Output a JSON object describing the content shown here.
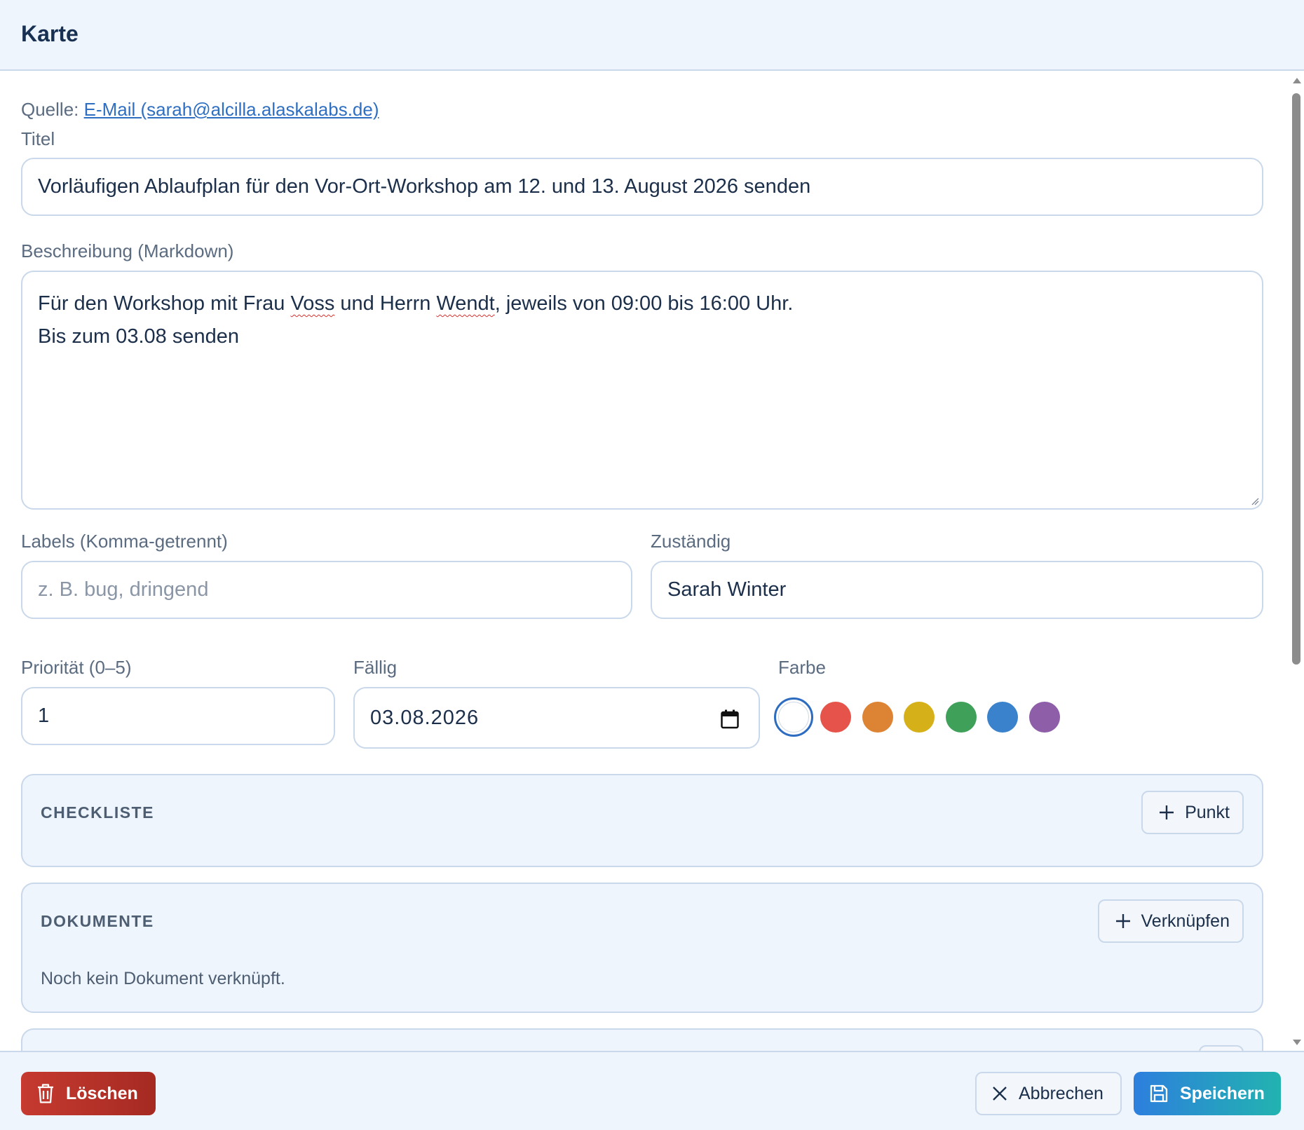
{
  "dialog": {
    "title": "Karte"
  },
  "source": {
    "label": "Quelle:",
    "link_text": "E-Mail (sarah@alcilla.alaskalabs.de)"
  },
  "title_field": {
    "label": "Titel",
    "value": "Vorläufigen Ablaufplan für den Vor-Ort-Workshop am 12. und 13. August 2026 senden"
  },
  "description": {
    "label": "Beschreibung (Markdown)",
    "line1_part1": "Für den Workshop mit Frau ",
    "line1_voss": "Voss",
    "line1_part2": " und Herrn ",
    "line1_wendt": "Wendt",
    "line1_part3": ", jeweils von 09:00 bis 16:00 Uhr.",
    "line2": "Bis zum 03.08 senden"
  },
  "labels_field": {
    "label": "Labels (Komma-getrennt)",
    "placeholder": "z. B. bug, dringend",
    "value": ""
  },
  "assignee_field": {
    "label": "Zuständig",
    "value": "Sarah Winter"
  },
  "priority_field": {
    "label": "Priorität (0–5)",
    "value": "1"
  },
  "due_field": {
    "label": "Fällig",
    "value": "03.08.2026"
  },
  "color_field": {
    "label": "Farbe",
    "selected": "none",
    "options": [
      "#ffffff",
      "#e5534b",
      "#dd8434",
      "#d5b019",
      "#3fa05a",
      "#3a83cc",
      "#8e5ea8"
    ]
  },
  "checklist": {
    "title": "CHECKLISTE",
    "add_label": "Punkt"
  },
  "documents": {
    "title": "DOKUMENTE",
    "link_label": "Verknüpfen",
    "empty_text": "Noch kein Dokument verknüpft."
  },
  "footer": {
    "delete_label": "Löschen",
    "cancel_label": "Abbrechen",
    "save_label": "Speichern"
  },
  "colors": {
    "accent": "#2d6cc0",
    "danger": "#b8322a",
    "save_gradient_start": "#2d7fdd",
    "save_gradient_end": "#22b3b0"
  }
}
